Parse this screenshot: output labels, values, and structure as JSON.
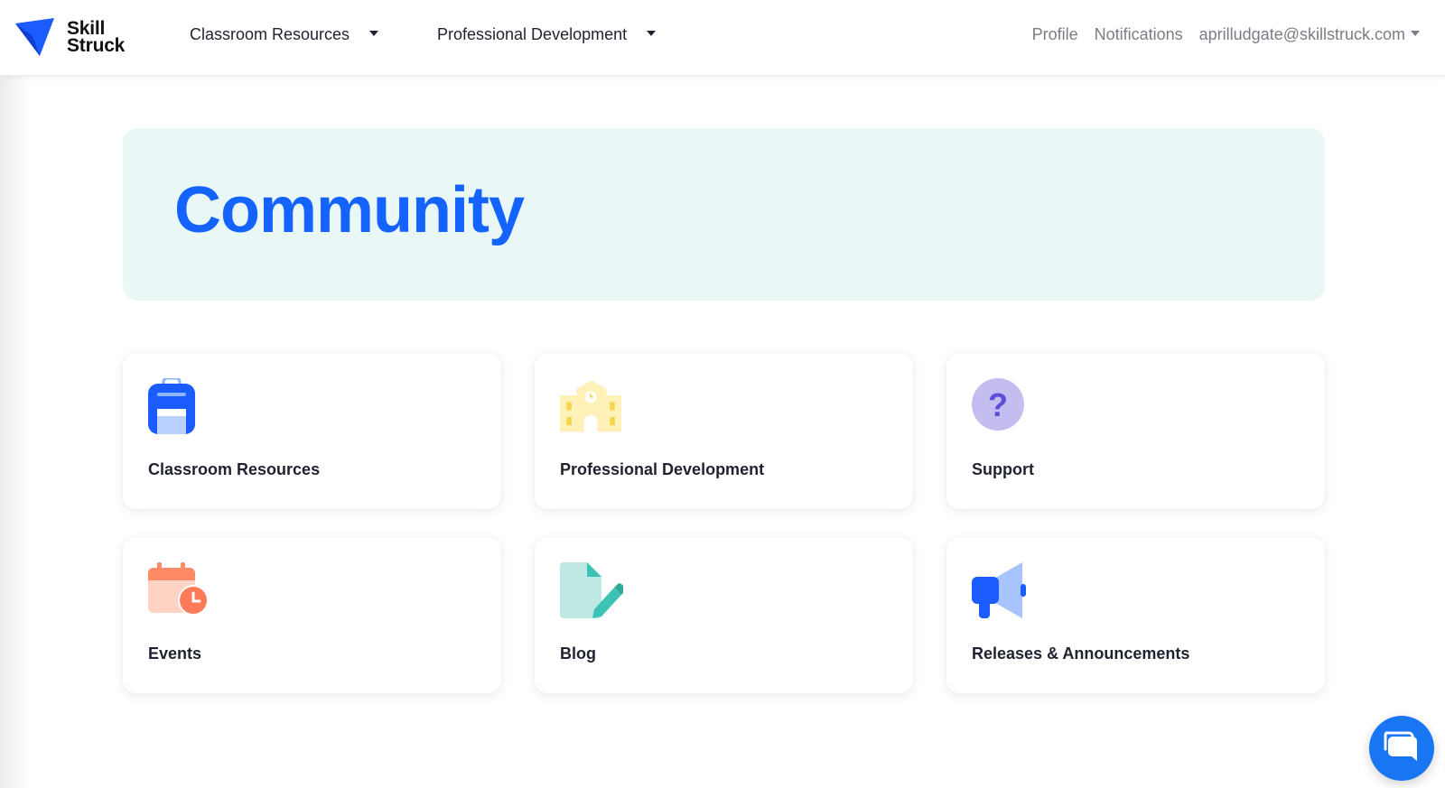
{
  "brand": {
    "line1": "Skill",
    "line2": "Struck",
    "color": "#1a5cff"
  },
  "nav": {
    "classroom_resources": "Classroom Resources",
    "professional_development": "Professional Development",
    "profile": "Profile",
    "notifications": "Notifications",
    "account_email": "aprilludgate@skillstruck.com"
  },
  "hero": {
    "title": "Community",
    "background": "#e9f8f7",
    "title_color": "#1563ff"
  },
  "cards": [
    {
      "label": "Classroom Resources",
      "icon": "backpack-icon"
    },
    {
      "label": "Professional Development",
      "icon": "school-building-icon"
    },
    {
      "label": "Support",
      "icon": "question-mark-icon"
    },
    {
      "label": "Events",
      "icon": "calendar-clock-icon"
    },
    {
      "label": "Blog",
      "icon": "document-pencil-icon"
    },
    {
      "label": "Releases & Announcements",
      "icon": "megaphone-icon"
    }
  ],
  "chat": {
    "icon": "chat-bubble-icon",
    "color": "#1876f2"
  }
}
